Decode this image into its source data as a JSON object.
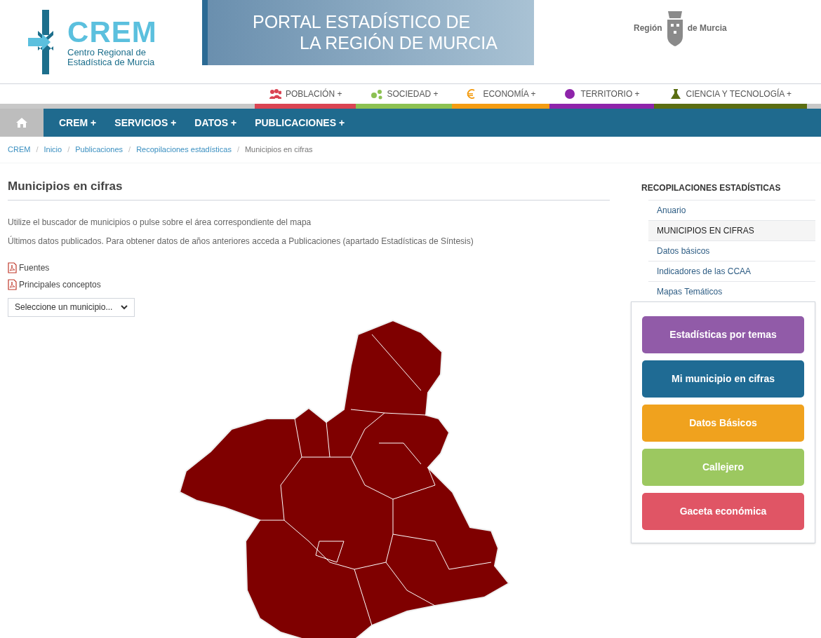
{
  "header": {
    "logo": {
      "acronym": "CREM",
      "line_1": "Centro Regional de",
      "line_2": "Estadística de Murcia"
    },
    "banner": {
      "line_1": "PORTAL ESTADÍSTICO DE",
      "line_2": "LA REGIÓN DE MURCIA"
    },
    "region_logo": {
      "left": "Región",
      "right": "de Murcia"
    }
  },
  "topics": [
    {
      "label": "POBLACIÓN",
      "plus": "+",
      "color": "#da4453"
    },
    {
      "label": "SOCIEDAD",
      "plus": "+",
      "color": "#8cc152"
    },
    {
      "label": "ECONOMÍA",
      "plus": "+",
      "color": "#f39c12"
    },
    {
      "label": "TERRITORIO",
      "plus": "+",
      "color": "#8e24aa"
    },
    {
      "label": "CIENCIA Y TECNOLOGÍA",
      "plus": "+",
      "color": "#5b6e12"
    }
  ],
  "nav": [
    {
      "label": "CREM +"
    },
    {
      "label": "SERVICIOS +"
    },
    {
      "label": "DATOS +"
    },
    {
      "label": "PUBLICACIONES +"
    }
  ],
  "breadcrumb": [
    "CREM",
    "Inicio",
    "Publicaciones",
    "Recopilaciones estadísticas",
    "Municipios en cifras"
  ],
  "breadcrumb_separator": "/",
  "page_title": "Municipios en cifras",
  "paragraphs": [
    "Utilize el buscador de municipios o pulse sobre el área correspondiente del mapa",
    "Últimos datos publicados. Para obtener datos de años anteriores acceda a Publicaciones (apartado Estadísticas de Síntesis)"
  ],
  "documents": [
    "Fuentes",
    "Principales conceptos"
  ],
  "municipality_select": {
    "placeholder": "Seleccione un municipio..."
  },
  "sidebar": {
    "title": "RECOPILACIONES ESTADÍSTICAS",
    "items": [
      {
        "label": "Anuario",
        "selected": false
      },
      {
        "label": "MUNICIPIOS EN CIFRAS",
        "selected": true
      },
      {
        "label": "Datos básicos",
        "selected": false
      },
      {
        "label": "Indicadores de las CCAA",
        "selected": false
      },
      {
        "label": "Mapas Temáticos",
        "selected": false
      }
    ]
  },
  "quick_links": [
    {
      "label": "Estadísticas por temas",
      "color": "#915ba8"
    },
    {
      "label": "Mi municipio en cifras",
      "color": "#1f6b94"
    },
    {
      "label": "Datos Básicos",
      "color": "#f0a21e"
    },
    {
      "label": "Callejero",
      "color": "#9cc860"
    },
    {
      "label": "Gaceta económica",
      "color": "#e05565"
    }
  ]
}
